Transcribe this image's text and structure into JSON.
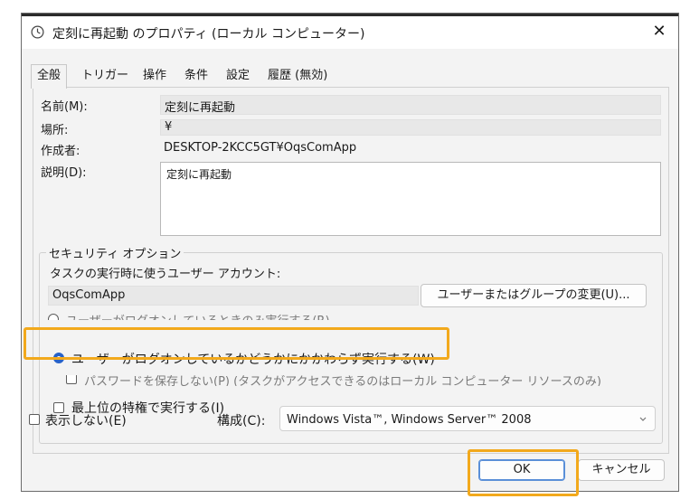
{
  "window": {
    "title": "定刻に再起動 のプロパティ (ローカル コンピューター)",
    "close_glyph": "✕"
  },
  "tabs": [
    "全般",
    "トリガー",
    "操作",
    "条件",
    "設定",
    "履歴 (無効)"
  ],
  "general": {
    "name_label": "名前(M):",
    "name_value": "定刻に再起動",
    "location_label": "場所:",
    "location_value": "¥",
    "author_label": "作成者:",
    "author_value": "DESKTOP-2KCC5GT¥OqsComApp",
    "description_label": "説明(D):",
    "description_value": "定刻に再起動"
  },
  "security": {
    "group_title": "セキュリティ オプション",
    "account_prompt": "タスクの実行時に使うユーザー アカウント:",
    "account_value": "OqsComApp",
    "change_button": "ユーザーまたはグループの変更(U)...",
    "radio_logged_on": "ユーザーがログオンしているときのみ実行する(R)",
    "radio_whether": "ユーザーがログオンしているかどうかにかかわらず実行する(W)",
    "no_store_password": "パスワードを保存しない(P) (タスクがアクセスできるのはローカル コンピューター リソースのみ)",
    "highest_privileges": "最上位の特権で実行する(I)"
  },
  "bottom": {
    "hidden_label": "表示しない(E)",
    "configure_label": "構成(C):",
    "configure_value": "Windows Vista™, Windows Server™ 2008",
    "ok": "OK",
    "cancel": "キャンセル"
  },
  "colors": {
    "highlight": "#f2a91c",
    "radio_selected": "#2762c8"
  },
  "icons": {
    "title": "clock-icon",
    "dropdown": "chevron-down-icon"
  }
}
